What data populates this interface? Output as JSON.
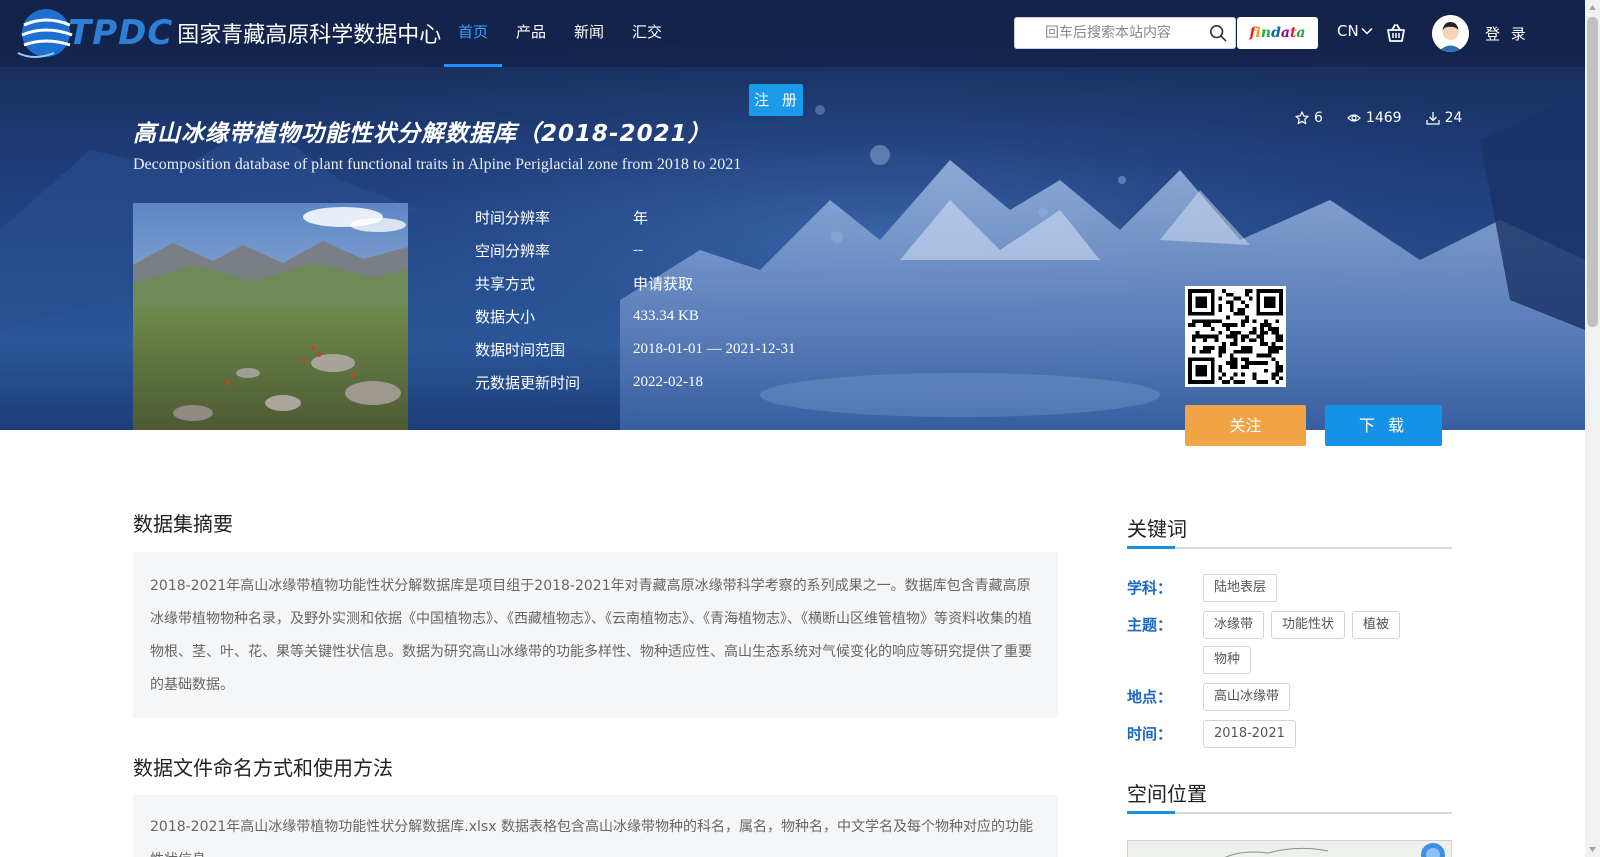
{
  "brand": {
    "logo_text": "TPDC",
    "site_name": "国家青藏高原科学数据中心"
  },
  "nav": {
    "items": [
      {
        "label": "首页",
        "active": true
      },
      {
        "label": "产品",
        "active": false
      },
      {
        "label": "新闻",
        "active": false
      },
      {
        "label": "汇交",
        "active": false
      }
    ]
  },
  "header": {
    "search_placeholder": "回车后搜索本站内容",
    "findata_label": "findata",
    "lang_label": "CN",
    "login_label": "登 录",
    "register_label": "注 册"
  },
  "dataset": {
    "title_cn": "高山冰缘带植物功能性状分解数据库（2018-2021）",
    "title_en": "Decomposition database of plant functional traits in Alpine Periglacial zone from 2018 to 2021",
    "stats": {
      "stars": "6",
      "views": "1469",
      "downloads": "24"
    },
    "meta": [
      {
        "key": "时间分辨率",
        "value": "年"
      },
      {
        "key": "空间分辨率",
        "value": "--"
      },
      {
        "key": "共享方式",
        "value": "申请获取"
      },
      {
        "key": "数据大小",
        "value": "433.34 KB"
      },
      {
        "key": "数据时间范围",
        "value": "2018-01-01 — 2021-12-31"
      },
      {
        "key": "元数据更新时间",
        "value": "2022-02-18"
      }
    ],
    "follow_label": "关注",
    "download_label": "下 载"
  },
  "sections": {
    "abstract_title": "数据集摘要",
    "abstract_text": "2018-2021年高山冰缘带植物功能性状分解数据库是项目组于2018-2021年对青藏高原冰缘带科学考察的系列成果之一。数据库包含青藏高原冰缘带植物物种名录，及野外实测和依据《中国植物志》、《西藏植物志》、《云南植物志》、《青海植物志》、《横断山区维管植物》等资料收集的植物根、茎、叶、花、果等关键性状信息。数据为研究高山冰缘带的功能多样性、物种适应性、高山生态系统对气候变化的响应等研究提供了重要的基础数据。",
    "usage_title": "数据文件命名方式和使用方法",
    "usage_text": "2018-2021年高山冰缘带植物功能性状分解数据库.xlsx 数据表格包含高山冰缘带物种的科名，属名，物种名，中文学名及每个物种对应的功能性状信息。"
  },
  "sidebar": {
    "keywords_title": "关键词",
    "keyword_groups": [
      {
        "label": "学科：",
        "tags": [
          "陆地表层"
        ]
      },
      {
        "label": "主题：",
        "tags": [
          "冰缘带",
          "功能性状",
          "植被",
          "物种"
        ]
      },
      {
        "label": "地点：",
        "tags": [
          "高山冰缘带"
        ]
      },
      {
        "label": "时间：",
        "tags": [
          "2018-2021"
        ]
      }
    ],
    "location_title": "空间位置"
  },
  "colors": {
    "accent_blue": "#1592e6",
    "follow_orange": "#f0a446",
    "keyword_label_blue": "#1d67c4",
    "nav_active": "#33a3ff"
  },
  "icons": [
    "search-icon",
    "cart-icon",
    "chevron-down-icon",
    "star-icon",
    "eye-icon",
    "download-icon",
    "qr-code-icon",
    "globe-logo-icon"
  ]
}
